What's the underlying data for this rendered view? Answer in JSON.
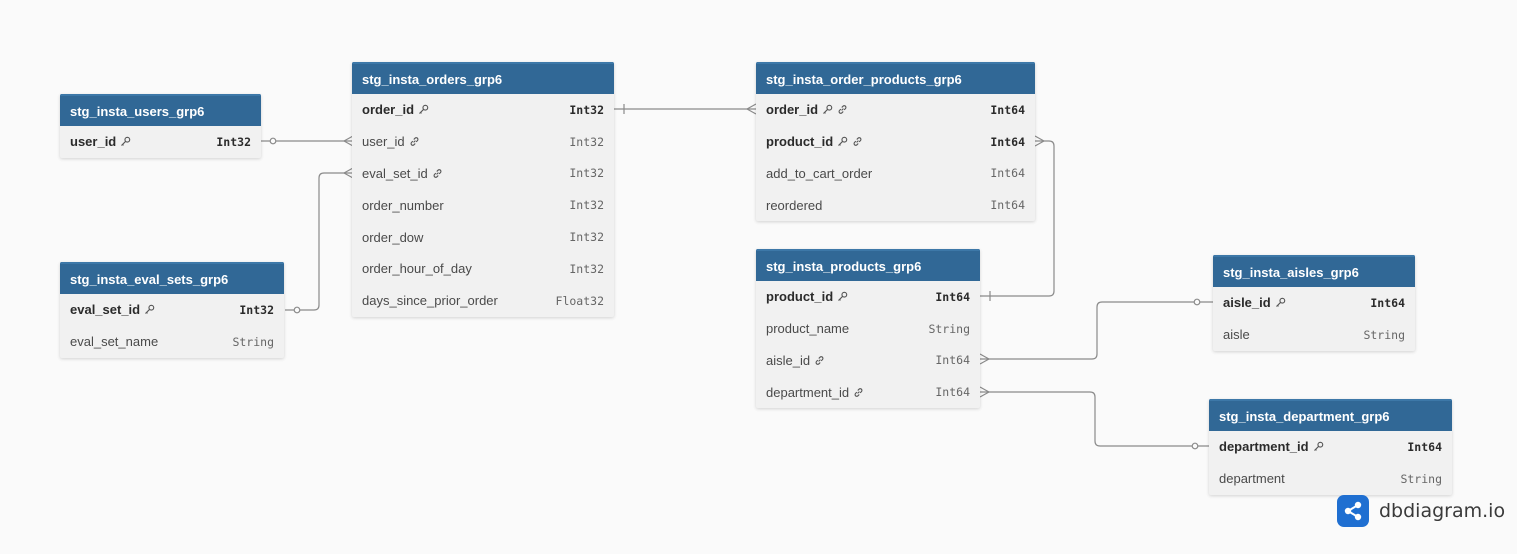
{
  "tables": [
    {
      "id": "users",
      "name": "stg_insta_users_grp6",
      "columns": [
        {
          "name": "user_id",
          "type": "Int32",
          "pk": true,
          "key": true,
          "fk": false
        }
      ]
    },
    {
      "id": "eval_sets",
      "name": "stg_insta_eval_sets_grp6",
      "columns": [
        {
          "name": "eval_set_id",
          "type": "Int32",
          "pk": true,
          "key": true,
          "fk": false
        },
        {
          "name": "eval_set_name",
          "type": "String",
          "pk": false,
          "key": false,
          "fk": false
        }
      ]
    },
    {
      "id": "orders",
      "name": "stg_insta_orders_grp6",
      "columns": [
        {
          "name": "order_id",
          "type": "Int32",
          "pk": true,
          "key": true,
          "fk": false
        },
        {
          "name": "user_id",
          "type": "Int32",
          "pk": false,
          "key": false,
          "fk": true
        },
        {
          "name": "eval_set_id",
          "type": "Int32",
          "pk": false,
          "key": false,
          "fk": true
        },
        {
          "name": "order_number",
          "type": "Int32",
          "pk": false,
          "key": false,
          "fk": false
        },
        {
          "name": "order_dow",
          "type": "Int32",
          "pk": false,
          "key": false,
          "fk": false
        },
        {
          "name": "order_hour_of_day",
          "type": "Int32",
          "pk": false,
          "key": false,
          "fk": false
        },
        {
          "name": "days_since_prior_order",
          "type": "Float32",
          "pk": false,
          "key": false,
          "fk": false
        }
      ]
    },
    {
      "id": "order_products",
      "name": "stg_insta_order_products_grp6",
      "columns": [
        {
          "name": "order_id",
          "type": "Int64",
          "pk": true,
          "key": true,
          "fk": true
        },
        {
          "name": "product_id",
          "type": "Int64",
          "pk": true,
          "key": true,
          "fk": true
        },
        {
          "name": "add_to_cart_order",
          "type": "Int64",
          "pk": false,
          "key": false,
          "fk": false
        },
        {
          "name": "reordered",
          "type": "Int64",
          "pk": false,
          "key": false,
          "fk": false
        }
      ]
    },
    {
      "id": "products",
      "name": "stg_insta_products_grp6",
      "columns": [
        {
          "name": "product_id",
          "type": "Int64",
          "pk": true,
          "key": true,
          "fk": false
        },
        {
          "name": "product_name",
          "type": "String",
          "pk": false,
          "key": false,
          "fk": false
        },
        {
          "name": "aisle_id",
          "type": "Int64",
          "pk": false,
          "key": false,
          "fk": true
        },
        {
          "name": "department_id",
          "type": "Int64",
          "pk": false,
          "key": false,
          "fk": true
        }
      ]
    },
    {
      "id": "aisles",
      "name": "stg_insta_aisles_grp6",
      "columns": [
        {
          "name": "aisle_id",
          "type": "Int64",
          "pk": true,
          "key": true,
          "fk": false
        },
        {
          "name": "aisle",
          "type": "String",
          "pk": false,
          "key": false,
          "fk": false
        }
      ]
    },
    {
      "id": "department",
      "name": "stg_insta_department_grp6",
      "columns": [
        {
          "name": "department_id",
          "type": "Int64",
          "pk": true,
          "key": true,
          "fk": false
        },
        {
          "name": "department",
          "type": "String",
          "pk": false,
          "key": false,
          "fk": false
        }
      ]
    }
  ],
  "relationships": [
    {
      "from": "users",
      "from_column": "user_id",
      "to": "orders",
      "to_column": "user_id",
      "cardinality": "zero-or-one-to-many"
    },
    {
      "from": "eval_sets",
      "from_column": "eval_set_id",
      "to": "orders",
      "to_column": "eval_set_id",
      "cardinality": "zero-or-one-to-many"
    },
    {
      "from": "orders",
      "from_column": "order_id",
      "to": "order_products",
      "to_column": "order_id",
      "cardinality": "one-to-many"
    },
    {
      "from": "products",
      "from_column": "product_id",
      "to": "order_products",
      "to_column": "product_id",
      "cardinality": "one-to-many"
    },
    {
      "from": "aisles",
      "from_column": "aisle_id",
      "to": "products",
      "to_column": "aisle_id",
      "cardinality": "zero-or-one-to-many"
    },
    {
      "from": "department",
      "from_column": "department_id",
      "to": "products",
      "to_column": "department_id",
      "cardinality": "zero-or-one-to-many"
    }
  ],
  "brand": {
    "name": "dbdiagram.io",
    "icon": "share-nodes-icon",
    "color": "#1f6fd1"
  },
  "colors": {
    "header": "#316896",
    "body": "#f1f1f1",
    "line": "#8a8a8a",
    "background": "#fafafa"
  }
}
